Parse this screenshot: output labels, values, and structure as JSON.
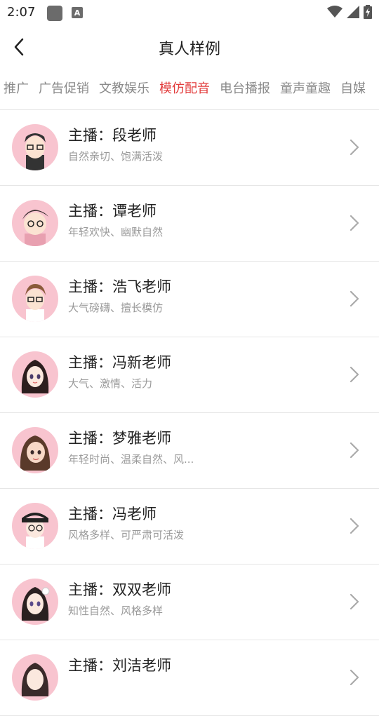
{
  "status_bar": {
    "time": "2:07",
    "icons": [
      "notification-square-icon",
      "a-icon",
      "wifi-icon",
      "signal-icon",
      "battery-icon"
    ]
  },
  "header": {
    "title": "真人样例",
    "back_icon": "chevron-left-icon"
  },
  "tabs": [
    {
      "label": "推广",
      "active": false
    },
    {
      "label": "广告促销",
      "active": false
    },
    {
      "label": "文教娱乐",
      "active": false
    },
    {
      "label": "模仿配音",
      "active": true
    },
    {
      "label": "电台播报",
      "active": false
    },
    {
      "label": "童声童趣",
      "active": false
    },
    {
      "label": "自媒",
      "active": false
    }
  ],
  "accent_color": "#e23b3b",
  "anchors": [
    {
      "title": "主播：段老师",
      "subtitle": "自然亲切、饱满活泼"
    },
    {
      "title": "主播：谭老师",
      "subtitle": "年轻欢快、幽默自然"
    },
    {
      "title": "主播：浩飞老师",
      "subtitle": "大气磅礴、擅长模仿"
    },
    {
      "title": "主播：冯新老师",
      "subtitle": "大气、激情、活力"
    },
    {
      "title": "主播：梦雅老师",
      "subtitle": "年轻时尚、温柔自然、风..."
    },
    {
      "title": "主播：冯老师",
      "subtitle": "风格多样、可严肃可活泼"
    },
    {
      "title": "主播：双双老师",
      "subtitle": "知性自然、风格多样"
    },
    {
      "title": "主播：刘洁老师",
      "subtitle": ""
    }
  ]
}
